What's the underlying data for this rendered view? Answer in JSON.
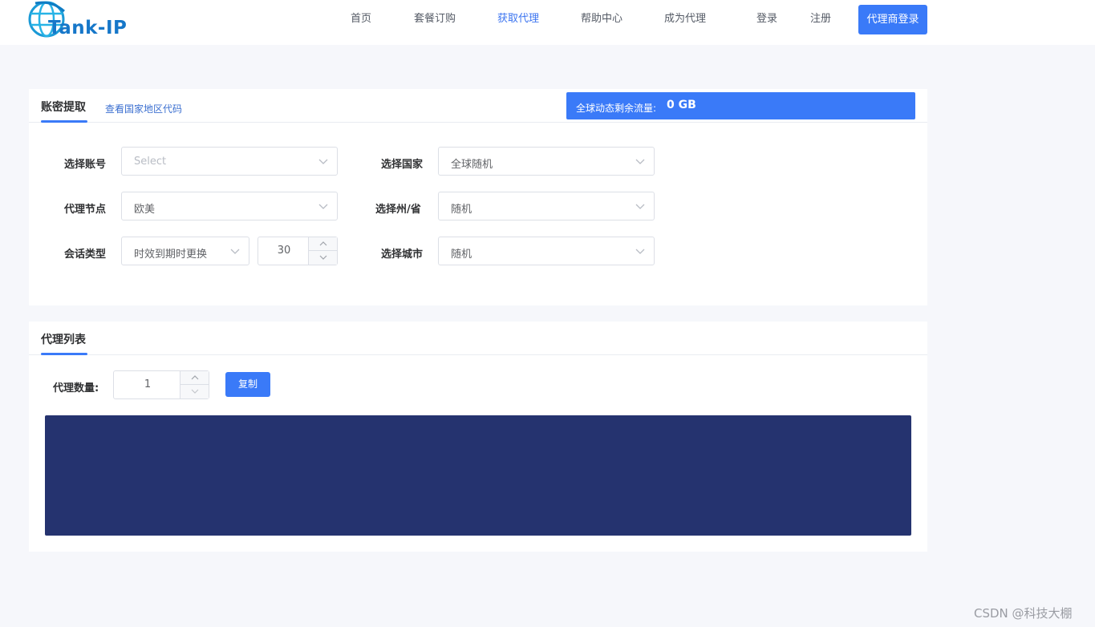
{
  "header": {
    "logo_text": "Tank-IP",
    "nav": [
      {
        "label": "首页"
      },
      {
        "label": "套餐订购"
      },
      {
        "label": "获取代理",
        "active": true
      },
      {
        "label": "帮助中心"
      },
      {
        "label": "成为代理"
      },
      {
        "label": "登录"
      },
      {
        "label": "注册"
      }
    ],
    "agent_login_label": "代理商登录"
  },
  "extract_card": {
    "tab_label": "账密提取",
    "country_code_link": "查看国家地区代码",
    "traffic_label": "全球动态剩余流量:",
    "traffic_value": "0 GB",
    "fields": {
      "account": {
        "label": "选择账号",
        "placeholder": "Select"
      },
      "country": {
        "label": "选择国家",
        "value": "全球随机"
      },
      "node": {
        "label": "代理节点",
        "value": "欧美"
      },
      "state": {
        "label": "选择州/省",
        "value": "随机"
      },
      "session": {
        "label": "会话类型",
        "value": "时效到期时更换",
        "minutes": "30"
      },
      "city": {
        "label": "选择城市",
        "value": "随机"
      }
    }
  },
  "proxy_card": {
    "tab_label": "代理列表",
    "count_label": "代理数量:",
    "count_value": "1",
    "copy_label": "复制"
  },
  "watermark": "CSDN @科技大棚",
  "colors": {
    "accent": "#3a7af8",
    "output_bg": "#25336f",
    "page_bg": "#f6f7fb"
  }
}
